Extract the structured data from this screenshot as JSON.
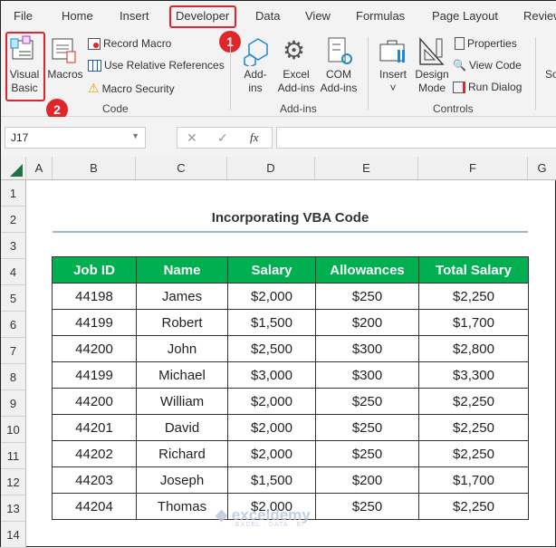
{
  "tabs": [
    "File",
    "Home",
    "Insert",
    "Developer",
    "Data",
    "View",
    "Formulas",
    "Page Layout",
    "Review"
  ],
  "ribbon": {
    "code": {
      "visual_basic": "Visual Basic",
      "macros": "Macros",
      "record_macro": "Record Macro",
      "use_relative": "Use Relative References",
      "macro_security": "Macro Security",
      "group": "Code"
    },
    "addins": {
      "addins": "Add-ins",
      "excel_addins": "Excel Add-ins",
      "com_addins": "COM Add-ins",
      "group": "Add-ins"
    },
    "controls": {
      "insert": "Insert",
      "design_mode": "Design Mode",
      "properties": "Properties",
      "view_code": "View Code",
      "run_dialog": "Run Dialog",
      "group": "Controls"
    },
    "partial": "So"
  },
  "badges": [
    "1",
    "2"
  ],
  "name_box": "J17",
  "formula_bar": {
    "fx": "fx",
    "value": ""
  },
  "columns": [
    "A",
    "B",
    "C",
    "D",
    "E",
    "F",
    "G"
  ],
  "rows": [
    "1",
    "2",
    "3",
    "4",
    "5",
    "6",
    "7",
    "8",
    "9",
    "10",
    "11",
    "12",
    "13",
    "14"
  ],
  "sheet": {
    "title": "Incorporating VBA Code",
    "headers": [
      "Job ID",
      "Name",
      "Salary",
      "Allowances",
      "Total Salary"
    ],
    "data": [
      [
        "44198",
        "James",
        "$2,000",
        "$250",
        "$2,250"
      ],
      [
        "44199",
        "Robert",
        "$1,500",
        "$200",
        "$1,700"
      ],
      [
        "44200",
        "John",
        "$2,500",
        "$300",
        "$2,800"
      ],
      [
        "44199",
        "Michael",
        "$3,000",
        "$300",
        "$3,300"
      ],
      [
        "44200",
        "William",
        "$2,000",
        "$250",
        "$2,250"
      ],
      [
        "44201",
        "David",
        "$2,000",
        "$250",
        "$2,250"
      ],
      [
        "44202",
        "Richard",
        "$2,000",
        "$250",
        "$2,250"
      ],
      [
        "44203",
        "Joseph",
        "$1,500",
        "$200",
        "$1,700"
      ],
      [
        "44204",
        "Thomas",
        "$2,000",
        "$250",
        "$2,250"
      ]
    ]
  },
  "watermark": {
    "name": "exceldemy",
    "tagline": "EXCEL · DATA · BI"
  },
  "colors": {
    "header_green": "#00b050",
    "highlight_red": "#e0262a",
    "title_underline": "#9fb6d9"
  }
}
